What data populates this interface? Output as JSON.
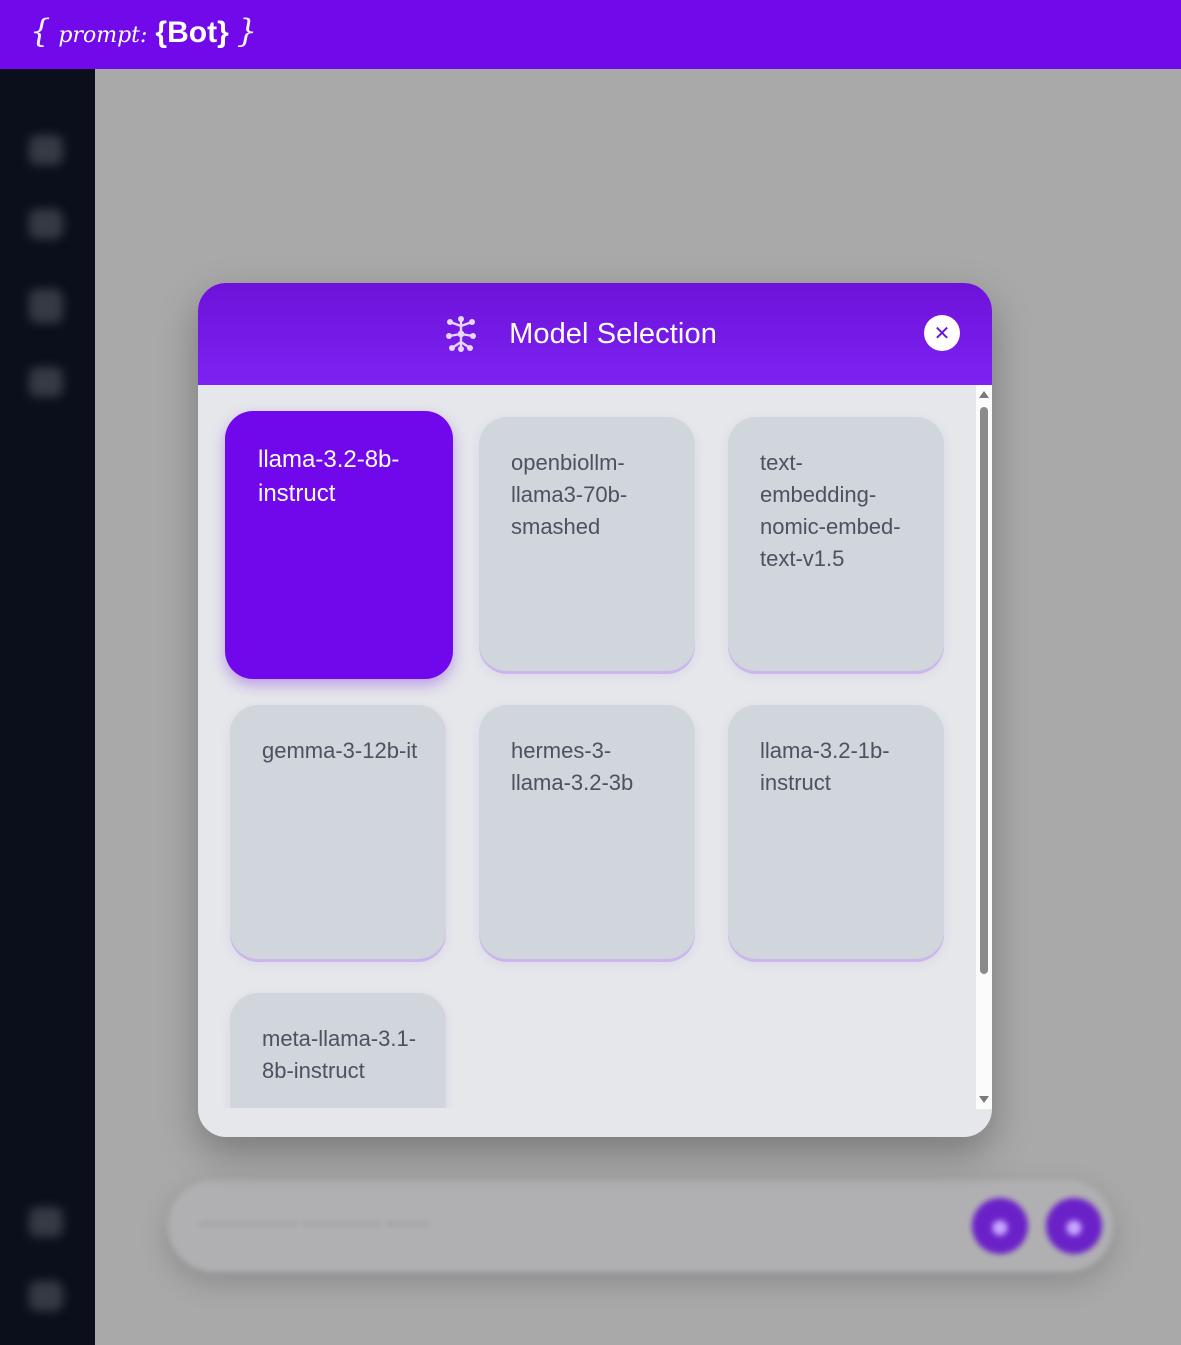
{
  "app": {
    "brand": {
      "open_brace": "{",
      "prompt": "prompt:",
      "inner_open": "{",
      "bot": "Bot",
      "inner_close": "}",
      "close_brace": "}"
    }
  },
  "colors": {
    "accent": "#7109ea",
    "sidebar": "#0a0f1b",
    "card": "#d1d5dc",
    "modal_bg": "#e5e7eb"
  },
  "modal": {
    "title": "Model Selection",
    "title_icon": "network-nodes-icon",
    "close_icon": "close-icon",
    "close_glyph": "✕",
    "selected_model": "llama-3.2-8b-instruct",
    "models": [
      {
        "label": "llama-3.2-8b-instruct",
        "selected": true
      },
      {
        "label": "openbiollm-llama3-70b-smashed",
        "selected": false
      },
      {
        "label": "text-embedding-nomic-embed-text-v1.5",
        "selected": false
      },
      {
        "label": "gemma-3-12b-it",
        "selected": false
      },
      {
        "label": "hermes-3-llama-3.2-3b",
        "selected": false
      },
      {
        "label": "llama-3.2-1b-instruct",
        "selected": false
      },
      {
        "label": "meta-llama-3.1-8b-instruct",
        "selected": false
      }
    ]
  }
}
